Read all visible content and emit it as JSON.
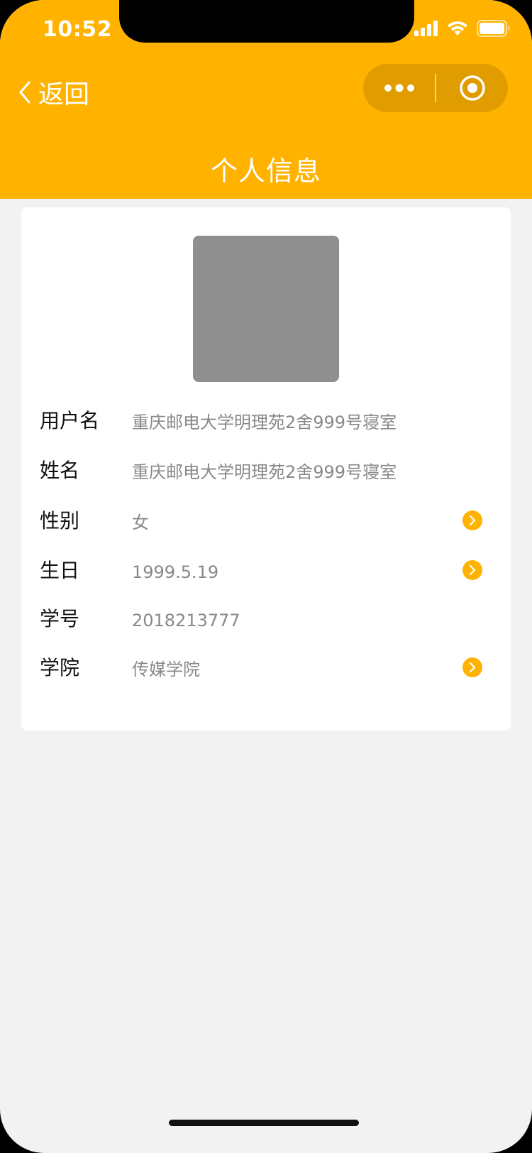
{
  "status_bar": {
    "time": "10:52"
  },
  "nav": {
    "back_label": "返回",
    "more_icon": "more-dots-icon",
    "close_icon": "target-circle-icon"
  },
  "page": {
    "title": "个人信息"
  },
  "colors": {
    "accent": "#ffb300",
    "capsule": "#e19d00",
    "background": "#f2f2f3",
    "card": "#ffffff",
    "avatar_placeholder": "#8f8f8f",
    "value_text": "#888888"
  },
  "profile": {
    "rows": [
      {
        "label": "用户名",
        "value": "重庆邮电大学明理苑2舍999号寝室",
        "has_arrow": false
      },
      {
        "label": "姓名",
        "value": "重庆邮电大学明理苑2舍999号寝室",
        "has_arrow": false
      },
      {
        "label": "性别",
        "value": "女",
        "has_arrow": true
      },
      {
        "label": "生日",
        "value": "1999.5.19",
        "has_arrow": true
      },
      {
        "label": "学号",
        "value": "2018213777",
        "has_arrow": false
      },
      {
        "label": "学院",
        "value": "传媒学院",
        "has_arrow": true
      }
    ]
  }
}
